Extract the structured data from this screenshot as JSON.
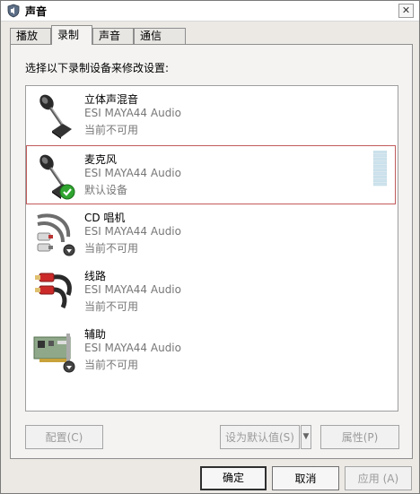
{
  "window": {
    "title": "声音",
    "close_symbol": "✕"
  },
  "tabs": [
    {
      "label": "播放",
      "active": false
    },
    {
      "label": "录制",
      "active": true
    },
    {
      "label": "声音",
      "active": false
    },
    {
      "label": "通信",
      "active": false
    }
  ],
  "prompt": "选择以下录制设备来修改设置:",
  "devices": [
    {
      "name": "立体声混音",
      "driver": "ESI MAYA44 Audio",
      "status": "当前不可用",
      "icon": "microphone-icon",
      "selected": false
    },
    {
      "name": "麦克风",
      "driver": "ESI MAYA44 Audio",
      "status": "默认设备",
      "icon": "microphone-icon",
      "selected": true,
      "badge": "default-check-icon",
      "level_percent": 0
    },
    {
      "name": "CD 唱机",
      "driver": "ESI MAYA44 Audio",
      "status": "当前不可用",
      "icon": "audio-cable-icon",
      "selected": false,
      "badge": "unplugged-icon"
    },
    {
      "name": "线路",
      "driver": "ESI MAYA44 Audio",
      "status": "当前不可用",
      "icon": "rca-cable-icon",
      "selected": false,
      "badge": "unplugged-icon"
    },
    {
      "name": "辅助",
      "driver": "ESI MAYA44 Audio",
      "status": "当前不可用",
      "icon": "sound-card-icon",
      "selected": false,
      "badge": "unplugged-icon"
    }
  ],
  "buttons": {
    "configure": "配置(C)",
    "set_default": "设为默认值(S)",
    "properties": "属性(P)",
    "ok": "确定",
    "cancel": "取消",
    "apply": "应用 (A)"
  },
  "colors": {
    "selection_border": "#c25b5b",
    "check_green": "#2fa52f"
  }
}
